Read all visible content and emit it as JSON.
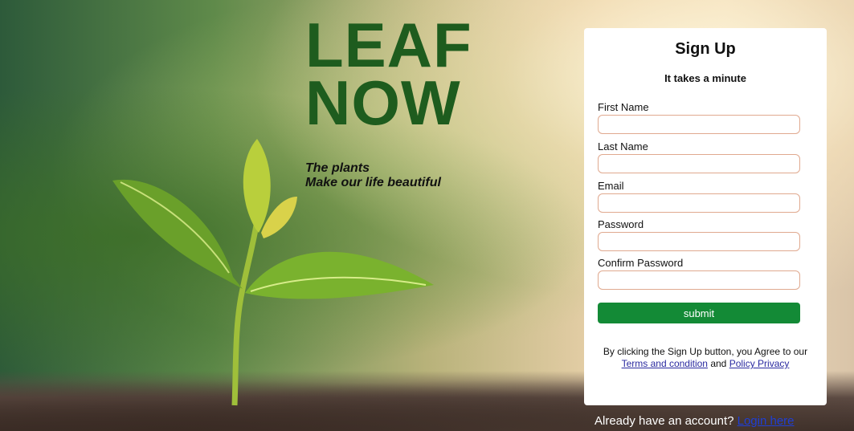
{
  "brand": {
    "line1": "LEAF",
    "line2": "NOW"
  },
  "tagline": {
    "line1": "The plants",
    "line2": "Make our life beautiful"
  },
  "form": {
    "title": "Sign Up",
    "subtitle": "It takes a minute",
    "fields": [
      {
        "label": "First Name",
        "value": "",
        "placeholder": ""
      },
      {
        "label": "Last Name",
        "value": "",
        "placeholder": ""
      },
      {
        "label": "Email",
        "value": "",
        "placeholder": ""
      },
      {
        "label": "Password",
        "value": "",
        "placeholder": ""
      },
      {
        "label": "Confirm Password",
        "value": "",
        "placeholder": ""
      }
    ],
    "submit_label": "submit",
    "terms_text": "By clicking the Sign Up button, you Agree to our",
    "terms_link": "Terms and condition",
    "and_text": "and",
    "privacy_link": "Policy Privacy"
  },
  "footer": {
    "already_text": "Already have an account?",
    "login_link": "Login here"
  },
  "colors": {
    "brand_green": "#1e5c1e",
    "submit_green": "#138a36",
    "input_border": "#e0a98f",
    "link_blue": "#1f3fd6"
  }
}
